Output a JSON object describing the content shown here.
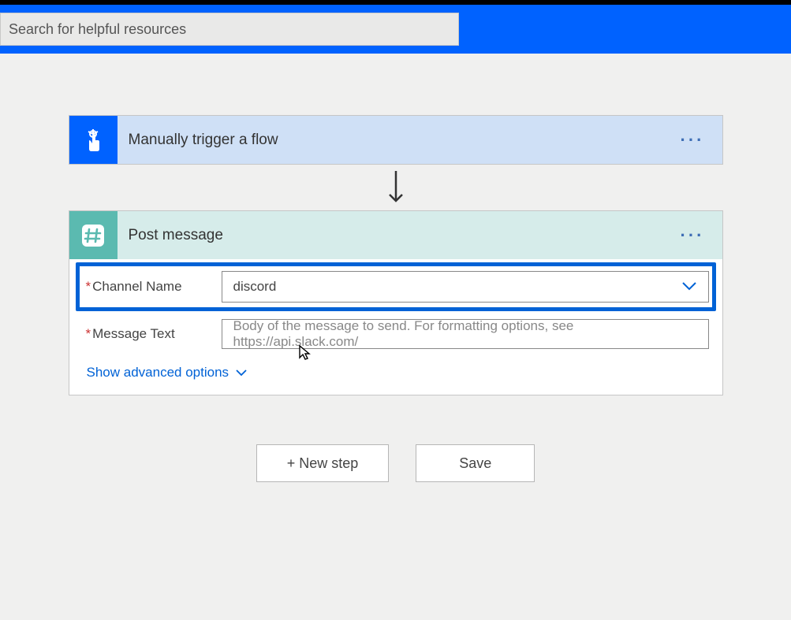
{
  "search": {
    "placeholder": "Search for helpful resources"
  },
  "trigger": {
    "title": "Manually trigger a flow"
  },
  "action": {
    "title": "Post message",
    "fields": {
      "channelName": {
        "label": "Channel Name",
        "value": "discord"
      },
      "messageText": {
        "label": "Message Text",
        "placeholder": "Body of the message to send. For formatting options, see https://api.slack.com/"
      }
    },
    "advanced": "Show advanced options"
  },
  "footer": {
    "newStep": "+ New step",
    "save": "Save"
  }
}
